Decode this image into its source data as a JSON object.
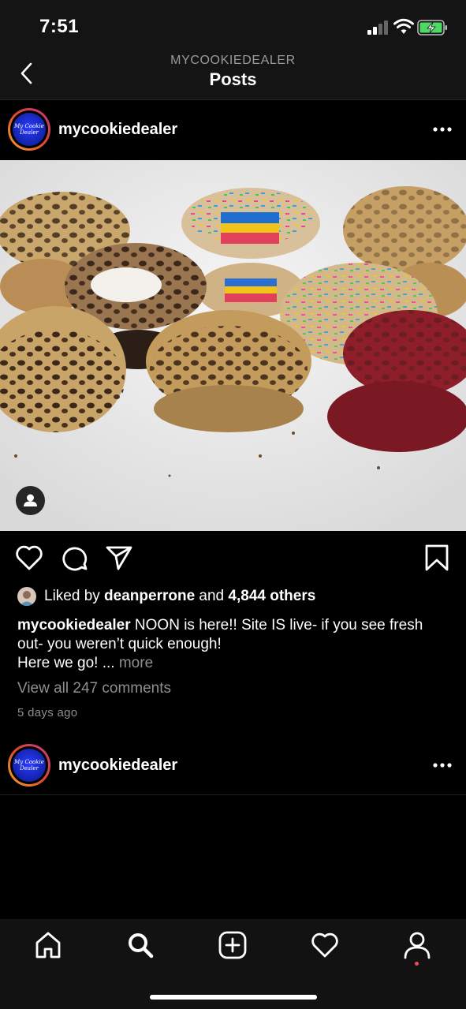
{
  "status_bar": {
    "time": "7:51"
  },
  "header": {
    "account": "MYCOOKIEDEALER",
    "title": "Posts"
  },
  "posts": [
    {
      "username": "mycookiedealer",
      "avatar_text": "My Cookie Dealer",
      "liked_by_prefix": "Liked by ",
      "liked_by_user": "deanperrone",
      "liked_by_and": " and ",
      "liked_by_others": "4,844 others",
      "caption_user": "mycookiedealer",
      "caption_text": " NOON is here!! Site IS live- if you see fresh out- you weren’t quick enough!",
      "caption_line2": "Here we go! ... ",
      "more_label": "more",
      "view_comments": "View all 247 comments",
      "time_ago": "5 days ago"
    },
    {
      "username": "mycookiedealer",
      "avatar_text": "My Cookie Dealer"
    }
  ],
  "icons": {
    "back": "chevron-left-icon",
    "more": "more-horizontal-icon",
    "like": "heart-icon",
    "comment": "comment-icon",
    "share": "send-icon",
    "save": "bookmark-icon",
    "tags": "user-tag-icon"
  },
  "tab_bar": [
    "home-icon",
    "search-icon",
    "add-post-icon",
    "activity-heart-icon",
    "profile-icon"
  ],
  "colors": {
    "background": "#000000",
    "bars": "#141414",
    "secondary_text": "#8e8e8e",
    "notification": "#ed4956"
  }
}
